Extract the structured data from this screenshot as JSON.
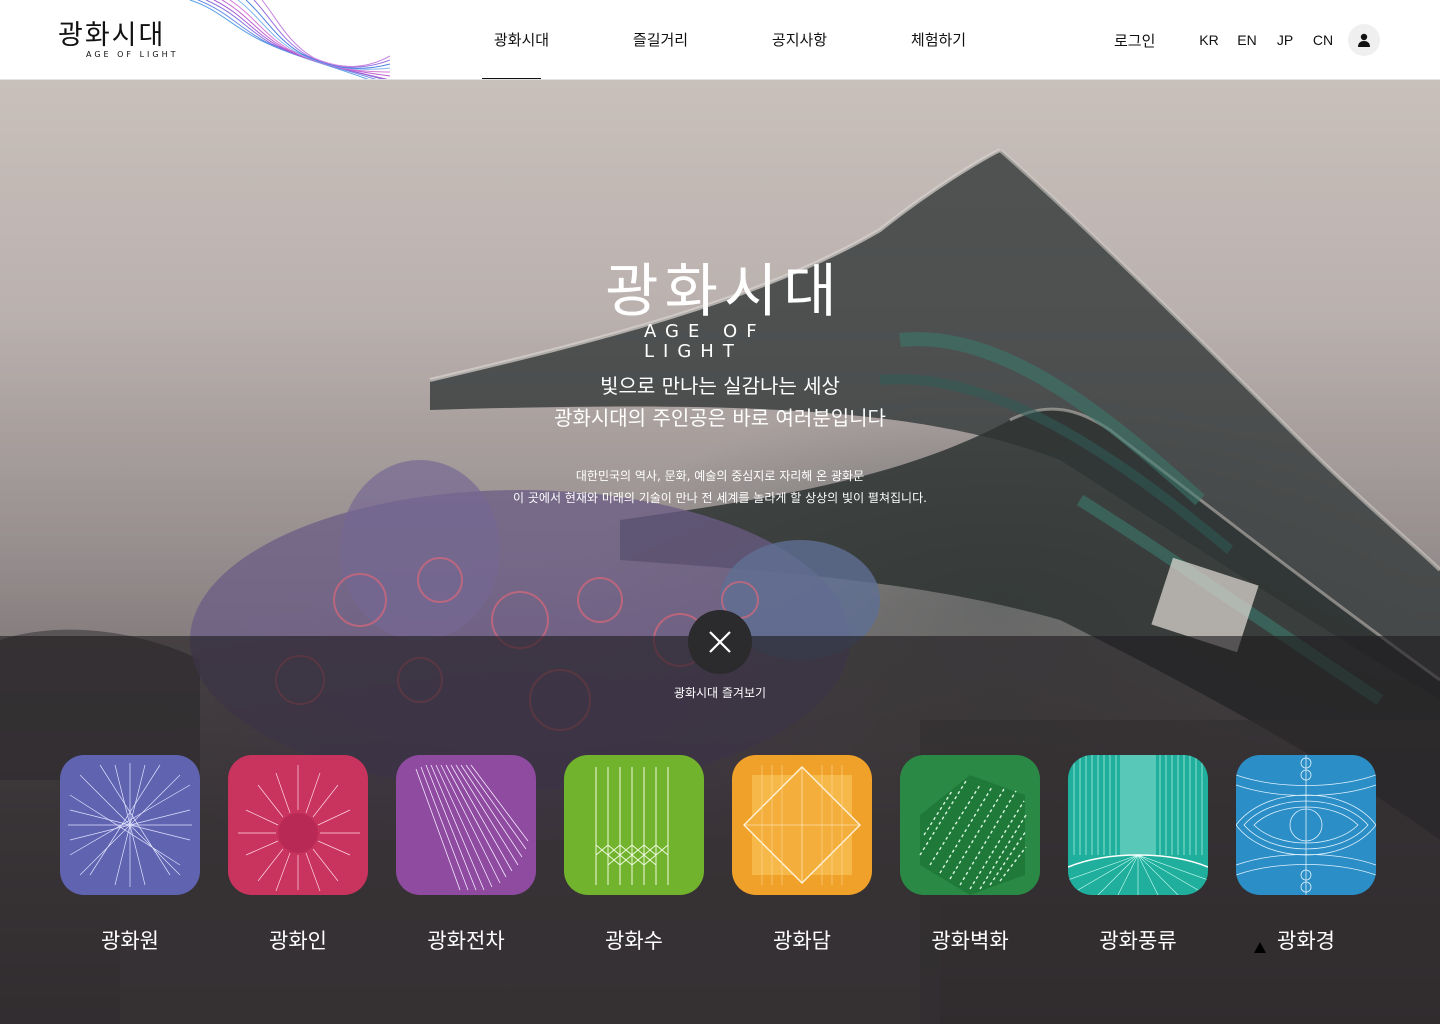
{
  "header": {
    "logo_ko": "광화시대",
    "logo_en": "AGE OF LIGHT",
    "nav": [
      {
        "label": "광화시대",
        "active": true
      },
      {
        "label": "즐길거리",
        "active": false
      },
      {
        "label": "공지사항",
        "active": false
      },
      {
        "label": "체험하기",
        "active": false
      }
    ],
    "login": "로그인",
    "languages": [
      "KR",
      "EN",
      "JP",
      "CN"
    ],
    "user_icon": "user-icon"
  },
  "hero": {
    "title_ko": "광화시대",
    "title_en": "AGE OF LIGHT",
    "tagline_1": "빛으로 만나는 실감나는 세상",
    "tagline_2": "광화시대의 주인공은 바로 여러분입니다",
    "desc_1": "대한민국의 역사, 문화, 예술의 중심지로 자리해 온 광화문",
    "desc_2": "이 곳에서 현재와 미래의 기술이 만나 전 세계를 놀라게 할 상상의 빛이 펼쳐집니다."
  },
  "panel": {
    "close_icon": "close-icon",
    "label": "광화시대 즐겨보기",
    "tiles": [
      {
        "label": "광화원",
        "color": "#6063b0"
      },
      {
        "label": "광화인",
        "color": "#c9345f"
      },
      {
        "label": "광화전차",
        "color": "#8e4b9f"
      },
      {
        "label": "광화수",
        "color": "#72b32e"
      },
      {
        "label": "광화담",
        "color": "#f0a12a"
      },
      {
        "label": "광화벽화",
        "color": "#2a8a45"
      },
      {
        "label": "광화풍류",
        "color": "#1faf9c"
      },
      {
        "label": "광화경",
        "color": "#2c8ec6"
      }
    ]
  }
}
